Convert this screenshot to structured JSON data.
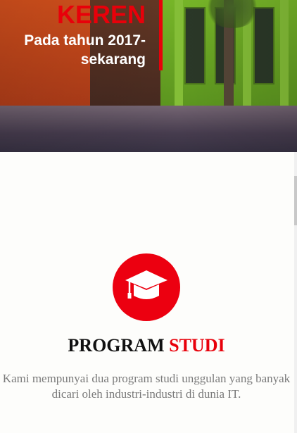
{
  "hero": {
    "title": "KEREN",
    "subtitle": "Pada tahun 2017-sekarang"
  },
  "program": {
    "icon": "graduation-cap-icon",
    "title_part1": "PROGRAM",
    "title_part2": "STUDI",
    "description": "Kami mempunyai dua program studi unggulan yang banyak dicari oleh industri-industri di dunia IT."
  },
  "colors": {
    "accent_red": "#e8000a",
    "text_dark": "#111111",
    "text_gray": "#7a7a7a",
    "background": "#fdfdfb"
  }
}
